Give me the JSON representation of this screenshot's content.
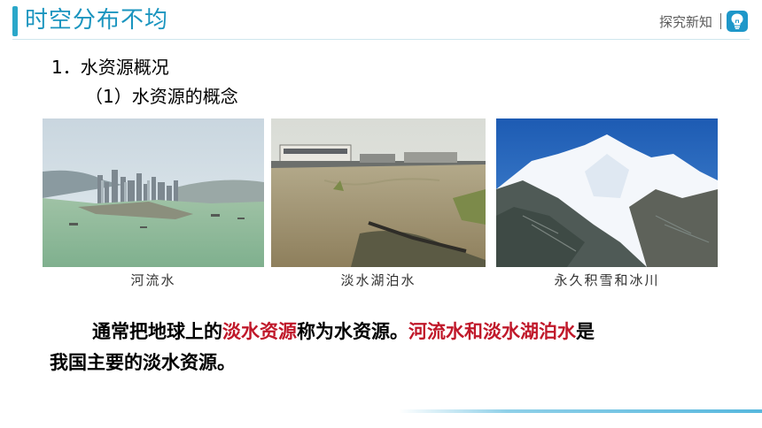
{
  "header": {
    "title": "时空分布不均",
    "section_label": "探究新知",
    "bulb_icon": "lightbulb-icon",
    "accent_color": "#1b95bf"
  },
  "content": {
    "heading1": "1．水资源概况",
    "heading2": "（1）水资源的概念",
    "photos": [
      {
        "caption": "河流水",
        "icon": "river-city-photo"
      },
      {
        "caption": "淡水湖泊水",
        "icon": "lake-photo"
      },
      {
        "caption": "永久积雪和冰川",
        "icon": "glacier-photo"
      }
    ],
    "paragraph": {
      "part1": "通常把地球上的",
      "part2_red": "淡水资源",
      "part3": "称为水资源。",
      "part4_red": "河流水和淡水湖泊水",
      "part5": "是",
      "line2": "我国主要的淡水资源。"
    }
  }
}
